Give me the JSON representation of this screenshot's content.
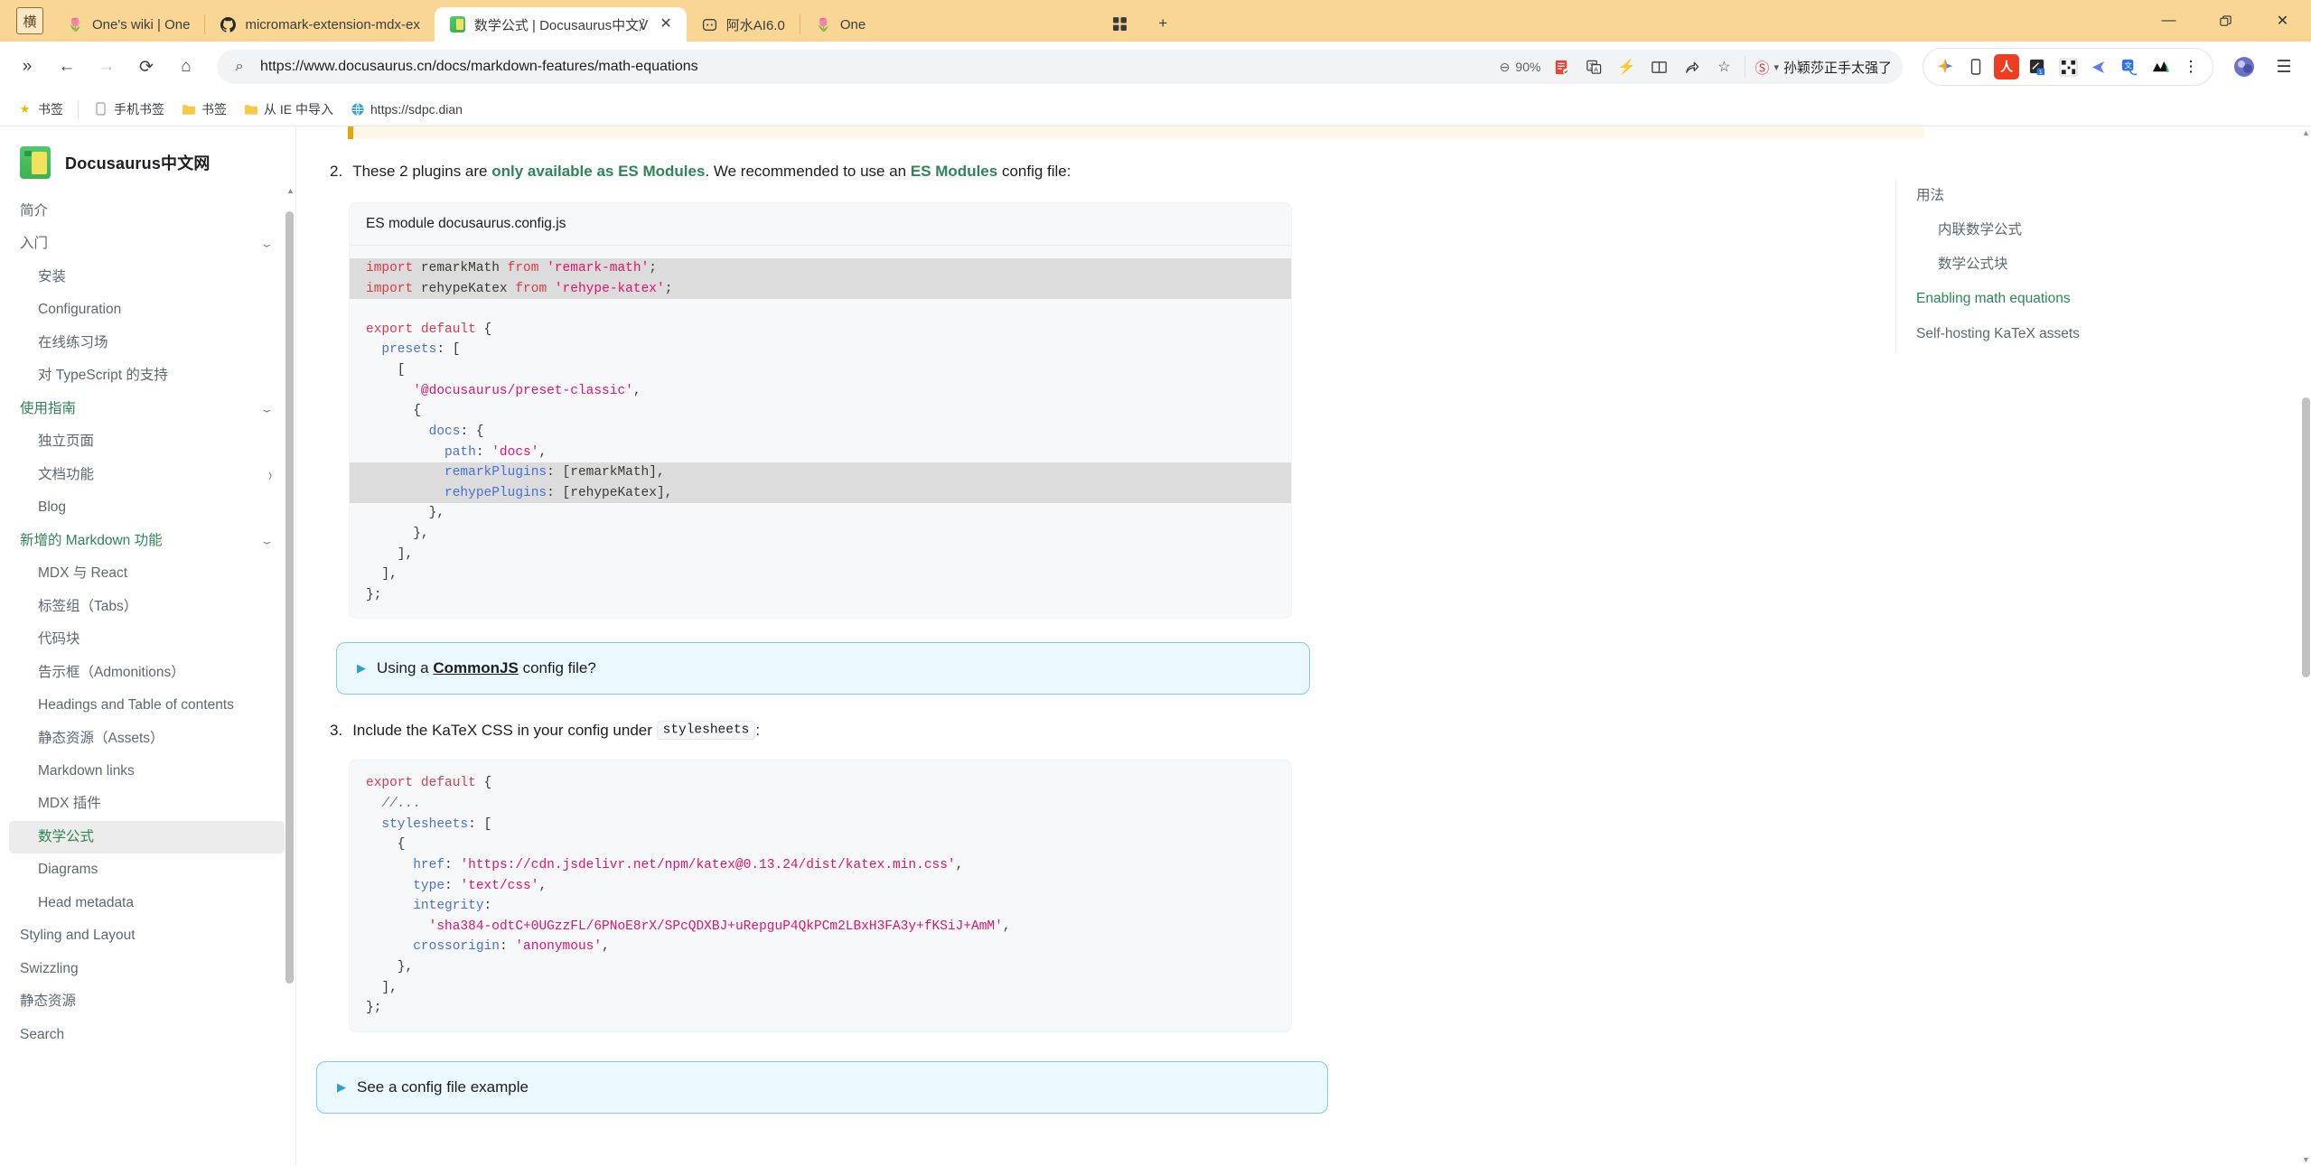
{
  "browser": {
    "window_controls": {
      "minimize": "—",
      "maximize": "❐",
      "close": "✕"
    },
    "system_icon": "横",
    "tabs": [
      {
        "title": "One's wiki | One",
        "favicon": "🌷",
        "active": false
      },
      {
        "title": "micromark-extension-mdx-ex",
        "favicon": "github-icon",
        "active": false
      },
      {
        "title": "数学公式 | Docusaurus中文℣",
        "favicon": "docusaurus-icon",
        "active": true
      },
      {
        "title": "阿水AI6.0",
        "favicon": "robot-icon",
        "active": false
      },
      {
        "title": "One",
        "favicon": "🌷",
        "active": false
      }
    ],
    "tab_search_label": "⊞",
    "new_tab_label": "+",
    "nav": {
      "overflow": "»",
      "back": "←",
      "forward": "→",
      "reload": "⟳",
      "home": "⌂"
    },
    "omnibox": {
      "search_icon": "⌕",
      "url": "https://www.docusaurus.cn/docs/markdown-features/math-equations",
      "zoom": "90%",
      "zoom_icon": "⊖",
      "icons": [
        "reader-mode-icon",
        "translate-icon",
        "lightning-icon",
        "book-icon",
        "share-icon",
        "bookmark-star-icon"
      ],
      "account_badge": "Ⓢ",
      "account_caret": "▾",
      "account_name": "孙颖莎正手太强了"
    },
    "extensions": [
      "gemini-sparkle-icon",
      "phone-icon",
      "adobe-acrobat-icon",
      "snip-icon",
      "qr-code-icon",
      "kite-icon",
      "translate-badge-icon",
      "wave-icon",
      "more-icon"
    ],
    "profile_icon": "profile-avatar",
    "menu_icon": "☰",
    "bookmarks": [
      {
        "label": "书签",
        "icon": "star-icon"
      },
      {
        "label": "手机书签",
        "icon": "phone-icon"
      },
      {
        "label": "书签",
        "icon": "folder-icon"
      },
      {
        "label": "从 IE 中导入",
        "icon": "folder-icon"
      },
      {
        "label": "https://sdpc.dian",
        "icon": "globe-icon"
      }
    ]
  },
  "site": {
    "brand": "Docusaurus中文网",
    "sidebar": [
      {
        "label": "简介",
        "level": 1,
        "chevron": "",
        "state": ""
      },
      {
        "label": "入门",
        "level": 1,
        "chevron": "down",
        "state": ""
      },
      {
        "label": "安装",
        "level": 2,
        "chevron": "",
        "state": ""
      },
      {
        "label": "Configuration",
        "level": 2,
        "chevron": "",
        "state": ""
      },
      {
        "label": "在线练习场",
        "level": 2,
        "chevron": "",
        "state": ""
      },
      {
        "label": "对 TypeScript 的支持",
        "level": 2,
        "chevron": "",
        "state": ""
      },
      {
        "label": "使用指南",
        "level": 1,
        "chevron": "down",
        "state": "catactive"
      },
      {
        "label": "独立页面",
        "level": 2,
        "chevron": "",
        "state": ""
      },
      {
        "label": "文档功能",
        "level": 2,
        "chevron": "right",
        "state": ""
      },
      {
        "label": "Blog",
        "level": 2,
        "chevron": "",
        "state": ""
      },
      {
        "label": "新增的 Markdown 功能",
        "level": 1,
        "chevron": "down",
        "state": "catactive"
      },
      {
        "label": "MDX 与 React",
        "level": 2,
        "chevron": "",
        "state": ""
      },
      {
        "label": "标签组（Tabs）",
        "level": 2,
        "chevron": "",
        "state": ""
      },
      {
        "label": "代码块",
        "level": 2,
        "chevron": "",
        "state": ""
      },
      {
        "label": "告示框（Admonitions）",
        "level": 2,
        "chevron": "",
        "state": ""
      },
      {
        "label": "Headings and Table of contents",
        "level": 2,
        "chevron": "",
        "state": ""
      },
      {
        "label": "静态资源（Assets）",
        "level": 2,
        "chevron": "",
        "state": ""
      },
      {
        "label": "Markdown links",
        "level": 2,
        "chevron": "",
        "state": ""
      },
      {
        "label": "MDX 插件",
        "level": 2,
        "chevron": "",
        "state": ""
      },
      {
        "label": "数学公式",
        "level": 2,
        "chevron": "",
        "state": "active"
      },
      {
        "label": "Diagrams",
        "level": 2,
        "chevron": "",
        "state": ""
      },
      {
        "label": "Head metadata",
        "level": 2,
        "chevron": "",
        "state": ""
      },
      {
        "label": "Styling and Layout",
        "level": 1,
        "chevron": "",
        "state": ""
      },
      {
        "label": "Swizzling",
        "level": 1,
        "chevron": "",
        "state": ""
      },
      {
        "label": "静态资源",
        "level": 1,
        "chevron": "",
        "state": ""
      },
      {
        "label": "Search",
        "level": 1,
        "chevron": "",
        "state": ""
      }
    ],
    "toc": [
      {
        "label": "用法",
        "level": 1,
        "active": false
      },
      {
        "label": "内联数学公式",
        "level": 2,
        "active": false
      },
      {
        "label": "数学公式块",
        "level": 2,
        "active": false
      },
      {
        "label": "Enabling math equations",
        "level": 1,
        "active": true
      },
      {
        "label": "Self-hosting KaTeX assets",
        "level": 1,
        "active": false
      }
    ]
  },
  "doc": {
    "step2": {
      "num": "2.",
      "pre": "These 2 plugins are ",
      "bold1": "only available as ES Modules",
      "mid": ". We recommended to use an ",
      "bold2": "ES Modules",
      "post": " config file:"
    },
    "codeblock1": {
      "title": "ES module docusaurus.config.js",
      "lines": [
        {
          "hl": true,
          "tokens": [
            {
              "t": "import",
              "c": "k"
            },
            {
              "t": " remarkMath ",
              "c": "pl"
            },
            {
              "t": "from",
              "c": "k"
            },
            {
              "t": " ",
              "c": "pl"
            },
            {
              "t": "'remark-math'",
              "c": "s"
            },
            {
              "t": ";",
              "c": "pl"
            }
          ]
        },
        {
          "hl": true,
          "tokens": [
            {
              "t": "import",
              "c": "k"
            },
            {
              "t": " rehypeKatex ",
              "c": "pl"
            },
            {
              "t": "from",
              "c": "k"
            },
            {
              "t": " ",
              "c": "pl"
            },
            {
              "t": "'rehype-katex'",
              "c": "s"
            },
            {
              "t": ";",
              "c": "pl"
            }
          ]
        },
        {
          "hl": false,
          "tokens": [
            {
              "t": "",
              "c": "pl"
            }
          ]
        },
        {
          "hl": false,
          "tokens": [
            {
              "t": "export default",
              "c": "k"
            },
            {
              "t": " {",
              "c": "pl"
            }
          ]
        },
        {
          "hl": false,
          "tokens": [
            {
              "t": "  ",
              "c": "pl"
            },
            {
              "t": "presets",
              "c": "pb"
            },
            {
              "t": ": [",
              "c": "pl"
            }
          ]
        },
        {
          "hl": false,
          "tokens": [
            {
              "t": "    [",
              "c": "pl"
            }
          ]
        },
        {
          "hl": false,
          "tokens": [
            {
              "t": "      ",
              "c": "pl"
            },
            {
              "t": "'@docusaurus/preset-classic'",
              "c": "s"
            },
            {
              "t": ",",
              "c": "pl"
            }
          ]
        },
        {
          "hl": false,
          "tokens": [
            {
              "t": "      {",
              "c": "pl"
            }
          ]
        },
        {
          "hl": false,
          "tokens": [
            {
              "t": "        ",
              "c": "pl"
            },
            {
              "t": "docs",
              "c": "pb"
            },
            {
              "t": ": {",
              "c": "pl"
            }
          ]
        },
        {
          "hl": false,
          "tokens": [
            {
              "t": "          ",
              "c": "pl"
            },
            {
              "t": "path",
              "c": "pb"
            },
            {
              "t": ": ",
              "c": "pl"
            },
            {
              "t": "'docs'",
              "c": "s"
            },
            {
              "t": ",",
              "c": "pl"
            }
          ]
        },
        {
          "hl": true,
          "tokens": [
            {
              "t": "          ",
              "c": "pl"
            },
            {
              "t": "remarkPlugins",
              "c": "pb"
            },
            {
              "t": ": [remarkMath],",
              "c": "pl"
            }
          ]
        },
        {
          "hl": true,
          "tokens": [
            {
              "t": "          ",
              "c": "pl"
            },
            {
              "t": "rehypePlugins",
              "c": "pb"
            },
            {
              "t": ": [rehypeKatex],",
              "c": "pl"
            }
          ]
        },
        {
          "hl": false,
          "tokens": [
            {
              "t": "        },",
              "c": "pl"
            }
          ]
        },
        {
          "hl": false,
          "tokens": [
            {
              "t": "      },",
              "c": "pl"
            }
          ]
        },
        {
          "hl": false,
          "tokens": [
            {
              "t": "    ],",
              "c": "pl"
            }
          ]
        },
        {
          "hl": false,
          "tokens": [
            {
              "t": "  ],",
              "c": "pl"
            }
          ]
        },
        {
          "hl": false,
          "tokens": [
            {
              "t": "};",
              "c": "pl"
            }
          ]
        }
      ]
    },
    "details1": {
      "marker": "▶",
      "pre": "Using a ",
      "bold": "CommonJS",
      "post": " config file?"
    },
    "step3": {
      "num": "3.",
      "pre": "Include the KaTeX CSS in your config under ",
      "code": "stylesheets",
      "post": ":"
    },
    "codeblock2": {
      "lines": [
        {
          "hl": false,
          "tokens": [
            {
              "t": "export default",
              "c": "k"
            },
            {
              "t": " {",
              "c": "pl"
            }
          ]
        },
        {
          "hl": false,
          "tokens": [
            {
              "t": "  //...",
              "c": "c"
            }
          ]
        },
        {
          "hl": false,
          "tokens": [
            {
              "t": "  ",
              "c": "pl"
            },
            {
              "t": "stylesheets",
              "c": "pb"
            },
            {
              "t": ": [",
              "c": "pl"
            }
          ]
        },
        {
          "hl": false,
          "tokens": [
            {
              "t": "    {",
              "c": "pl"
            }
          ]
        },
        {
          "hl": false,
          "tokens": [
            {
              "t": "      ",
              "c": "pl"
            },
            {
              "t": "href",
              "c": "pb"
            },
            {
              "t": ": ",
              "c": "pl"
            },
            {
              "t": "'https://cdn.jsdelivr.net/npm/katex@0.13.24/dist/katex.min.css'",
              "c": "s"
            },
            {
              "t": ",",
              "c": "pl"
            }
          ]
        },
        {
          "hl": false,
          "tokens": [
            {
              "t": "      ",
              "c": "pl"
            },
            {
              "t": "type",
              "c": "pb"
            },
            {
              "t": ": ",
              "c": "pl"
            },
            {
              "t": "'text/css'",
              "c": "s"
            },
            {
              "t": ",",
              "c": "pl"
            }
          ]
        },
        {
          "hl": false,
          "tokens": [
            {
              "t": "      ",
              "c": "pl"
            },
            {
              "t": "integrity",
              "c": "pb"
            },
            {
              "t": ":",
              "c": "pl"
            }
          ]
        },
        {
          "hl": false,
          "tokens": [
            {
              "t": "        ",
              "c": "pl"
            },
            {
              "t": "'sha384-odtC+0UGzzFL/6PNoE8rX/SPcQDXBJ+uRepguP4QkPCm2LBxH3FA3y+fKSiJ+AmM'",
              "c": "s"
            },
            {
              "t": ",",
              "c": "pl"
            }
          ]
        },
        {
          "hl": false,
          "tokens": [
            {
              "t": "      ",
              "c": "pl"
            },
            {
              "t": "crossorigin",
              "c": "pb"
            },
            {
              "t": ": ",
              "c": "pl"
            },
            {
              "t": "'anonymous'",
              "c": "s"
            },
            {
              "t": ",",
              "c": "pl"
            }
          ]
        },
        {
          "hl": false,
          "tokens": [
            {
              "t": "    },",
              "c": "pl"
            }
          ]
        },
        {
          "hl": false,
          "tokens": [
            {
              "t": "  ],",
              "c": "pl"
            }
          ]
        },
        {
          "hl": false,
          "tokens": [
            {
              "t": "};",
              "c": "pl"
            }
          ]
        }
      ]
    },
    "details2": {
      "marker": "▶",
      "pre": "See a config file example",
      "bold": "",
      "post": ""
    }
  }
}
